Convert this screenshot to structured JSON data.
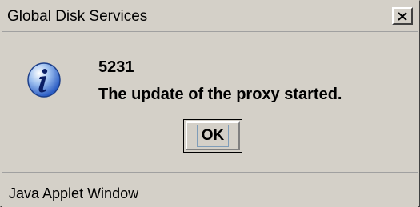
{
  "window": {
    "title": "Global Disk Services",
    "close_symbol": "X"
  },
  "message": {
    "code": "5231",
    "text": "The update of the proxy started.",
    "icon": "info-icon"
  },
  "buttons": {
    "ok_label": "OK"
  },
  "status": {
    "text": "Java Applet Window"
  },
  "colors": {
    "dialog_background": "#d4d0c8",
    "icon_blue": "#3b6fd6"
  }
}
